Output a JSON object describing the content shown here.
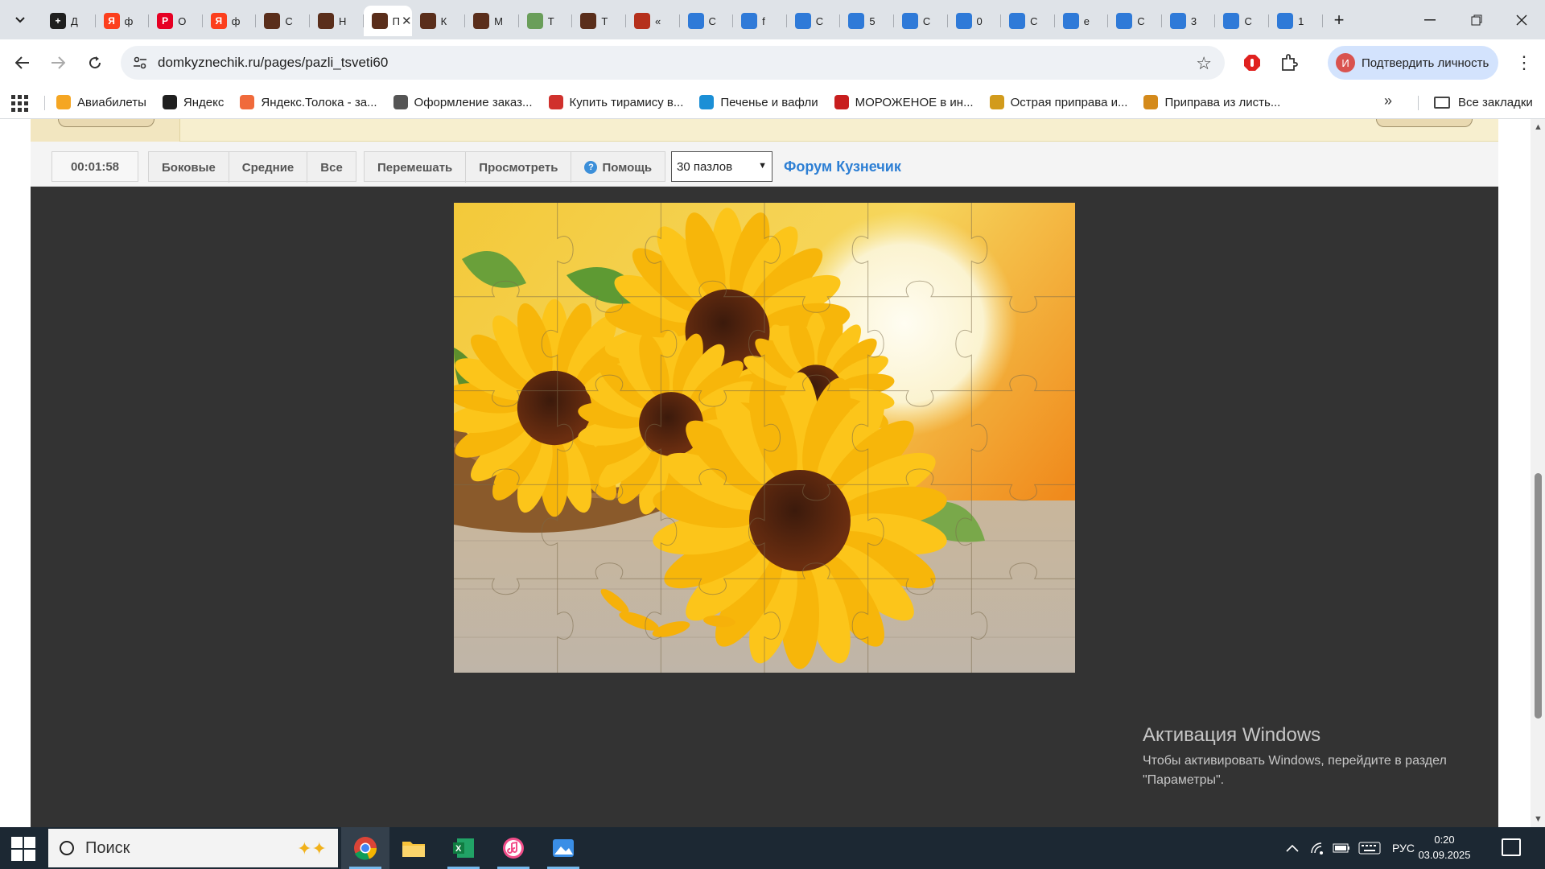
{
  "browser": {
    "tabs": [
      {
        "title": "Д",
        "icon": "plus-dark-icon",
        "color": "#1f1f1f",
        "glyph": "+"
      },
      {
        "title": "ф",
        "icon": "yandex-icon",
        "color": "#fc3f1d",
        "glyph": "Я"
      },
      {
        "title": "О",
        "icon": "pinterest-icon",
        "color": "#e60023",
        "glyph": "P"
      },
      {
        "title": "ф",
        "icon": "yandex-icon",
        "color": "#fc3f1d",
        "glyph": "Я"
      },
      {
        "title": "С",
        "icon": "site-icon",
        "color": "#5a2e1b",
        "glyph": ""
      },
      {
        "title": "Н",
        "icon": "site-icon",
        "color": "#5a2e1b",
        "glyph": ""
      },
      {
        "title": "П",
        "icon": "site-icon",
        "color": "#5a2e1b",
        "glyph": "",
        "active": true
      },
      {
        "title": "К",
        "icon": "site-icon",
        "color": "#5a2e1b",
        "glyph": ""
      },
      {
        "title": "М",
        "icon": "site-icon",
        "color": "#5a2e1b",
        "glyph": ""
      },
      {
        "title": "Т",
        "icon": "landscape-icon",
        "color": "#6a9e5a",
        "glyph": ""
      },
      {
        "title": "Т",
        "icon": "site-icon",
        "color": "#5a2e1b",
        "glyph": ""
      },
      {
        "title": "«",
        "icon": "red-site-icon",
        "color": "#b5301c",
        "glyph": ""
      },
      {
        "title": "С",
        "icon": "gallery-icon",
        "color": "#2f7ad8",
        "glyph": ""
      },
      {
        "title": "f",
        "icon": "gallery-icon",
        "color": "#2f7ad8",
        "glyph": ""
      },
      {
        "title": "С",
        "icon": "gallery-icon",
        "color": "#2f7ad8",
        "glyph": ""
      },
      {
        "title": "5",
        "icon": "gallery-icon",
        "color": "#2f7ad8",
        "glyph": ""
      },
      {
        "title": "С",
        "icon": "gallery-icon",
        "color": "#2f7ad8",
        "glyph": ""
      },
      {
        "title": "0",
        "icon": "gallery-icon",
        "color": "#2f7ad8",
        "glyph": ""
      },
      {
        "title": "С",
        "icon": "gallery-icon",
        "color": "#2f7ad8",
        "glyph": ""
      },
      {
        "title": "е",
        "icon": "gallery-icon",
        "color": "#2f7ad8",
        "glyph": ""
      },
      {
        "title": "С",
        "icon": "gallery-icon",
        "color": "#2f7ad8",
        "glyph": ""
      },
      {
        "title": "3",
        "icon": "gallery-icon",
        "color": "#2f7ad8",
        "glyph": ""
      },
      {
        "title": "С",
        "icon": "gallery-icon",
        "color": "#2f7ad8",
        "glyph": ""
      },
      {
        "title": "1",
        "icon": "gallery-icon",
        "color": "#2f7ad8",
        "glyph": ""
      }
    ],
    "url": "domkyznechik.ru/pages/pazli_tsveti60",
    "profile_label": "Подтвердить личность",
    "profile_initial": "И"
  },
  "bookmarks": {
    "items": [
      {
        "label": "Авиабилеты",
        "icon": "plane-icon",
        "color": "#f5a623"
      },
      {
        "label": "Яндекс",
        "icon": "yandex-plus-icon",
        "color": "#1f1f1f"
      },
      {
        "label": "Яндекс.Толока - за...",
        "icon": "toloka-icon",
        "color": "#f06a3b"
      },
      {
        "label": "Оформление заказ...",
        "icon": "globe-icon",
        "color": "#555555"
      },
      {
        "label": "Купить тирамису в...",
        "icon": "cake-icon",
        "color": "#d0312d"
      },
      {
        "label": "Печенье и вафли",
        "icon": "cookie-icon",
        "color": "#1b8fd6"
      },
      {
        "label": "МОРОЖЕНОЕ в ин...",
        "icon": "d-icon",
        "color": "#c81e1e"
      },
      {
        "label": "Острая приправа и...",
        "icon": "spice-icon",
        "color": "#d29b1c"
      },
      {
        "label": "Приправа из листь...",
        "icon": "herb-icon",
        "color": "#d48a1b"
      }
    ],
    "all_label": "Все закладки"
  },
  "puzzle_page": {
    "timer": "00:01:58",
    "sides_label": "Боковые",
    "middle_label": "Средние",
    "all_label": "Все",
    "shuffle_label": "Перемешать",
    "preview_label": "Просмотреть",
    "help_label": "Помощь",
    "pieces_selected": "30 пазлов",
    "forum_label": "Форум Кузнечик",
    "grid_cols": 6,
    "grid_rows": 5
  },
  "watermark": {
    "title": "Активация Windows",
    "text": "Чтобы активировать Windows, перейдите в раздел \"Параметры\"."
  },
  "taskbar": {
    "search_placeholder": "Поиск",
    "apps": [
      "chrome-icon",
      "file-explorer-icon",
      "excel-icon",
      "itunes-icon",
      "photos-icon"
    ],
    "language": "РУС",
    "time": "0:20",
    "date": "03.09.2025"
  },
  "colors": {
    "accent": "#2d7fd4",
    "puzzle_bg": "#333333",
    "banner": "#f7efcf"
  }
}
